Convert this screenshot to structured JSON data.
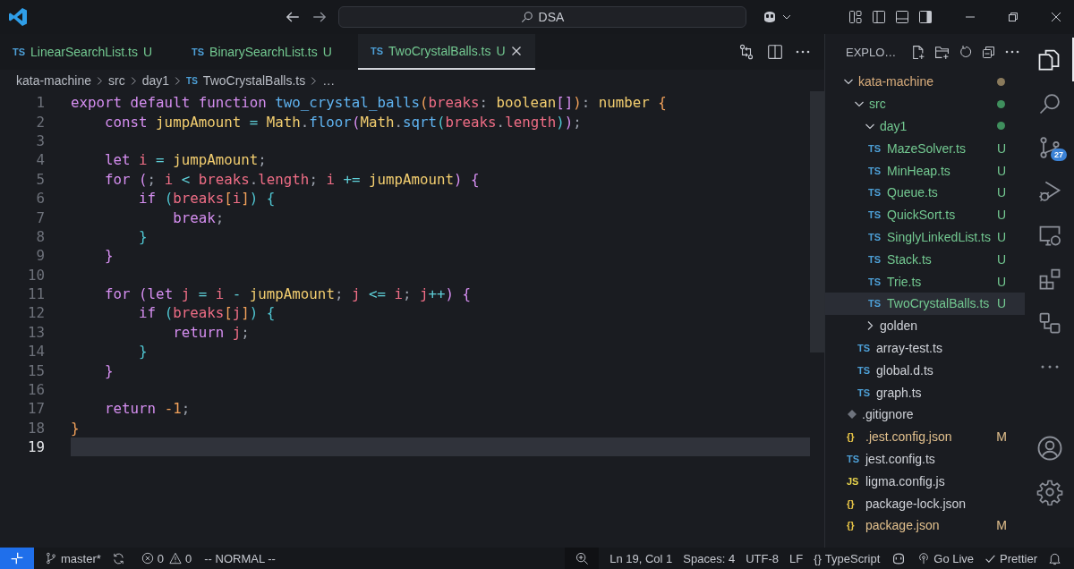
{
  "title_bar": {
    "search": "DSA"
  },
  "tabs": [
    {
      "lang": "TS",
      "name": "LinearSearchList.ts",
      "badge": "U",
      "selected": false
    },
    {
      "lang": "TS",
      "name": "BinarySearchList.ts",
      "badge": "U",
      "selected": false
    },
    {
      "lang": "TS",
      "name": "TwoCrystalBalls.ts",
      "badge": "U",
      "selected": true
    }
  ],
  "breadcrumbs": [
    {
      "label": "kata-machine"
    },
    {
      "label": "src"
    },
    {
      "label": "day1"
    },
    {
      "lang": "TS",
      "label": "TwoCrystalBalls.ts"
    },
    {
      "label": "…"
    }
  ],
  "editor": {
    "lines": [
      {
        "number": "1",
        "current": false,
        "tokens": [
          {
            "text": "export default function ",
            "kind": "kw"
          },
          {
            "text": "two_crystal_balls",
            "kind": "fn"
          },
          {
            "text": "(",
            "kind": "b1"
          },
          {
            "text": "breaks",
            "kind": "var"
          },
          {
            "text": ": ",
            "kind": "punc"
          },
          {
            "text": "boolean",
            "kind": "type"
          },
          {
            "text": "[]",
            "kind": "b2"
          },
          {
            "text": ")",
            "kind": "b1"
          },
          {
            "text": ": ",
            "kind": "punc"
          },
          {
            "text": "number",
            "kind": "type"
          },
          {
            "text": " {",
            "kind": "b1"
          }
        ]
      },
      {
        "number": "2",
        "current": false,
        "tokens": [
          {
            "text": "    const ",
            "kind": "kw"
          },
          {
            "text": "jumpAmount",
            "kind": "type"
          },
          {
            "text": " = ",
            "kind": "op"
          },
          {
            "text": "Math",
            "kind": "type"
          },
          {
            "text": ".",
            "kind": "punc"
          },
          {
            "text": "floor",
            "kind": "fn"
          },
          {
            "text": "(",
            "kind": "b2"
          },
          {
            "text": "Math",
            "kind": "type"
          },
          {
            "text": ".",
            "kind": "punc"
          },
          {
            "text": "sqrt",
            "kind": "fn"
          },
          {
            "text": "(",
            "kind": "b3"
          },
          {
            "text": "breaks",
            "kind": "var"
          },
          {
            "text": ".",
            "kind": "punc"
          },
          {
            "text": "length",
            "kind": "var"
          },
          {
            "text": ")",
            "kind": "b3"
          },
          {
            "text": ")",
            "kind": "b2"
          },
          {
            "text": ";",
            "kind": "punc"
          }
        ]
      },
      {
        "number": "3",
        "current": false
      },
      {
        "number": "4",
        "current": false,
        "tokens": [
          {
            "text": "    let ",
            "kind": "kw"
          },
          {
            "text": "i",
            "kind": "var"
          },
          {
            "text": " = ",
            "kind": "op"
          },
          {
            "text": "jumpAmount",
            "kind": "type"
          },
          {
            "text": ";",
            "kind": "punc"
          }
        ]
      },
      {
        "number": "5",
        "current": false,
        "tokens": [
          {
            "text": "    for ",
            "kind": "kw"
          },
          {
            "text": "(",
            "kind": "b2"
          },
          {
            "text": "; ",
            "kind": "punc"
          },
          {
            "text": "i",
            "kind": "var"
          },
          {
            "text": " < ",
            "kind": "op"
          },
          {
            "text": "breaks",
            "kind": "var"
          },
          {
            "text": ".",
            "kind": "punc"
          },
          {
            "text": "length",
            "kind": "var"
          },
          {
            "text": "; ",
            "kind": "punc"
          },
          {
            "text": "i",
            "kind": "var"
          },
          {
            "text": " += ",
            "kind": "op"
          },
          {
            "text": "jumpAmount",
            "kind": "type"
          },
          {
            "text": ")",
            "kind": "b2"
          },
          {
            "text": " {",
            "kind": "b2"
          }
        ]
      },
      {
        "number": "6",
        "current": false,
        "tokens": [
          {
            "text": "        if ",
            "kind": "kw"
          },
          {
            "text": "(",
            "kind": "b3"
          },
          {
            "text": "breaks",
            "kind": "var"
          },
          {
            "text": "[",
            "kind": "b1"
          },
          {
            "text": "i",
            "kind": "var"
          },
          {
            "text": "]",
            "kind": "b1"
          },
          {
            "text": ")",
            "kind": "b3"
          },
          {
            "text": " {",
            "kind": "b3"
          }
        ]
      },
      {
        "number": "7",
        "current": false,
        "tokens": [
          {
            "text": "            break",
            "kind": "kw"
          },
          {
            "text": ";",
            "kind": "punc"
          }
        ]
      },
      {
        "number": "8",
        "current": false,
        "tokens": [
          {
            "text": "        }",
            "kind": "b3"
          }
        ]
      },
      {
        "number": "9",
        "current": false,
        "tokens": [
          {
            "text": "    }",
            "kind": "b2"
          }
        ]
      },
      {
        "number": "10",
        "current": false
      },
      {
        "number": "11",
        "current": false,
        "tokens": [
          {
            "text": "    for ",
            "kind": "kw"
          },
          {
            "text": "(",
            "kind": "b2"
          },
          {
            "text": "let ",
            "kind": "kw"
          },
          {
            "text": "j",
            "kind": "var"
          },
          {
            "text": " = ",
            "kind": "op"
          },
          {
            "text": "i",
            "kind": "var"
          },
          {
            "text": " - ",
            "kind": "op"
          },
          {
            "text": "jumpAmount",
            "kind": "type"
          },
          {
            "text": "; ",
            "kind": "punc"
          },
          {
            "text": "j",
            "kind": "var"
          },
          {
            "text": " <= ",
            "kind": "op"
          },
          {
            "text": "i",
            "kind": "var"
          },
          {
            "text": "; ",
            "kind": "punc"
          },
          {
            "text": "j",
            "kind": "var"
          },
          {
            "text": "++",
            "kind": "op"
          },
          {
            "text": ")",
            "kind": "b2"
          },
          {
            "text": " {",
            "kind": "b2"
          }
        ]
      },
      {
        "number": "12",
        "current": false,
        "tokens": [
          {
            "text": "        if ",
            "kind": "kw"
          },
          {
            "text": "(",
            "kind": "b3"
          },
          {
            "text": "breaks",
            "kind": "var"
          },
          {
            "text": "[",
            "kind": "b1"
          },
          {
            "text": "j",
            "kind": "var"
          },
          {
            "text": "]",
            "kind": "b1"
          },
          {
            "text": ")",
            "kind": "b3"
          },
          {
            "text": " {",
            "kind": "b3"
          }
        ]
      },
      {
        "number": "13",
        "current": false,
        "tokens": [
          {
            "text": "            return ",
            "kind": "kw"
          },
          {
            "text": "j",
            "kind": "var"
          },
          {
            "text": ";",
            "kind": "punc"
          }
        ]
      },
      {
        "number": "14",
        "current": false,
        "tokens": [
          {
            "text": "        }",
            "kind": "b3"
          }
        ]
      },
      {
        "number": "15",
        "current": false,
        "tokens": [
          {
            "text": "    }",
            "kind": "b2"
          }
        ]
      },
      {
        "number": "16",
        "current": false
      },
      {
        "number": "17",
        "current": false,
        "tokens": [
          {
            "text": "    return ",
            "kind": "kw"
          },
          {
            "text": "-1",
            "kind": "num"
          },
          {
            "text": ";",
            "kind": "punc"
          }
        ]
      },
      {
        "number": "18",
        "current": false,
        "tokens": [
          {
            "text": "}",
            "kind": "b1"
          }
        ]
      },
      {
        "number": "19",
        "current": true
      }
    ]
  },
  "explorer": {
    "title": "EXPLO…",
    "tree": [
      {
        "name": "kata-machine",
        "kind": "folder",
        "expanded": true,
        "color": "#d9ad7c",
        "dot": {
          "color": "#8a7a5c"
        },
        "children": [
          {
            "name": "src",
            "kind": "folder",
            "expanded": true,
            "color": "#73c991",
            "dot": {
              "color": "#3f8f5d"
            },
            "children": [
              {
                "name": "day1",
                "kind": "folder",
                "expanded": true,
                "color": "#73c991",
                "dot": {
                  "color": "#3f8f5d"
                },
                "children": [
                  {
                    "name": "MazeSolver.ts",
                    "kind": "ts",
                    "icon_text": "TS",
                    "color": "#73c991",
                    "badge": "U",
                    "selected": false
                  },
                  {
                    "name": "MinHeap.ts",
                    "kind": "ts",
                    "icon_text": "TS",
                    "color": "#73c991",
                    "badge": "U",
                    "selected": false
                  },
                  {
                    "name": "Queue.ts",
                    "kind": "ts",
                    "icon_text": "TS",
                    "color": "#73c991",
                    "badge": "U",
                    "selected": false
                  },
                  {
                    "name": "QuickSort.ts",
                    "kind": "ts",
                    "icon_text": "TS",
                    "color": "#73c991",
                    "badge": "U",
                    "selected": false
                  },
                  {
                    "name": "SinglyLinkedList.ts",
                    "kind": "ts",
                    "icon_text": "TS",
                    "color": "#73c991",
                    "badge": "U",
                    "selected": false
                  },
                  {
                    "name": "Stack.ts",
                    "kind": "ts",
                    "icon_text": "TS",
                    "color": "#73c991",
                    "badge": "U",
                    "selected": false
                  },
                  {
                    "name": "Trie.ts",
                    "kind": "ts",
                    "icon_text": "TS",
                    "color": "#73c991",
                    "badge": "U",
                    "selected": false
                  },
                  {
                    "name": "TwoCrystalBalls.ts",
                    "kind": "ts",
                    "icon_text": "TS",
                    "color": "#73c991",
                    "badge": "U",
                    "selected": true
                  }
                ]
              },
              {
                "name": "golden",
                "kind": "folder",
                "expanded": false
              },
              {
                "name": "array-test.ts",
                "kind": "ts",
                "icon_text": "TS",
                "selected": false
              },
              {
                "name": "global.d.ts",
                "kind": "ts",
                "icon_text": "TS",
                "selected": false
              },
              {
                "name": "graph.ts",
                "kind": "ts",
                "icon_text": "TS",
                "selected": false
              }
            ]
          },
          {
            "name": ".gitignore",
            "kind": "git",
            "selected": false
          },
          {
            "name": ".jest.config.json",
            "kind": "json",
            "icon_text": "{}",
            "color": "#e2c08d",
            "badge": "M",
            "selected": false
          },
          {
            "name": "jest.config.ts",
            "kind": "ts",
            "icon_text": "TS",
            "selected": false
          },
          {
            "name": "ligma.config.js",
            "kind": "js",
            "icon_text": "JS",
            "selected": false
          },
          {
            "name": "package-lock.json",
            "kind": "json",
            "icon_text": "{}",
            "selected": false
          },
          {
            "name": "package.json",
            "kind": "json",
            "icon_text": "{}",
            "color": "#e2c08d",
            "badge": "M",
            "selected": false
          }
        ]
      }
    ]
  },
  "activity_bar": [
    {
      "kind": "explorer",
      "selected": true
    },
    {
      "kind": "search",
      "selected": false
    },
    {
      "kind": "source-control",
      "selected": false,
      "badge": "27"
    },
    {
      "kind": "run-debug",
      "selected": false
    },
    {
      "kind": "remote",
      "selected": false
    },
    {
      "kind": "extensions",
      "selected": false
    },
    {
      "kind": "diagram",
      "selected": false
    },
    {
      "kind": "more",
      "selected": false
    },
    {
      "kind": "account",
      "selected": false
    },
    {
      "kind": "settings",
      "selected": false
    }
  ],
  "status_bar": {
    "branch": "master*",
    "errors": "0",
    "warnings": "0",
    "mode": "-- NORMAL --",
    "position": "Ln 19, Col 1",
    "indent": "Spaces: 4",
    "encoding": "UTF-8",
    "eol": "LF",
    "language_icon": "{}",
    "language": "TypeScript",
    "go_live": "Go Live",
    "formatter": "Prettier"
  }
}
